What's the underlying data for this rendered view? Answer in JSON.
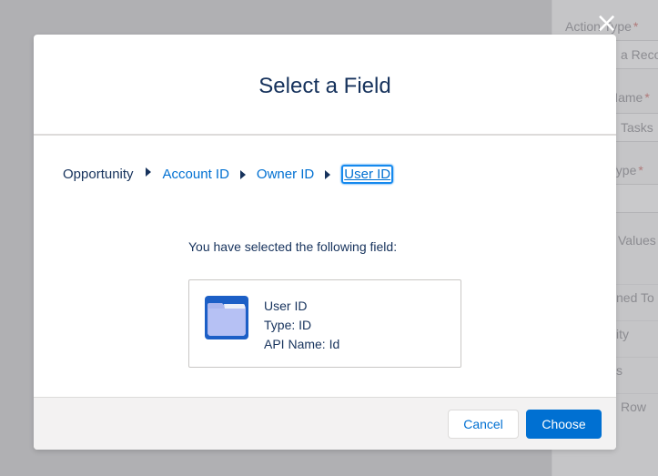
{
  "background": {
    "labels": [
      {
        "text": "Action Type",
        "required": "*"
      },
      {
        "text": "Name",
        "required": "*"
      },
      {
        "text": "Type",
        "required": "*"
      }
    ],
    "inputs": [
      "a Reco",
      "Tasks"
    ],
    "set_values_label": "Values",
    "rows": [
      "ned To",
      "ity",
      "s",
      "Row"
    ],
    "close_icon": "×"
  },
  "modal": {
    "title": "Select a Field",
    "breadcrumb": {
      "root": "Opportunity",
      "items": [
        "Account ID",
        "Owner ID"
      ],
      "active": "User ID"
    },
    "selected_prompt": "You have selected the following field:",
    "field": {
      "icon": "folder-icon",
      "name": "User ID",
      "type_line": "Type: ID",
      "api_line": "API Name: Id"
    },
    "footer": {
      "cancel_label": "Cancel",
      "choose_label": "Choose"
    }
  },
  "colors": {
    "brand": "#0070d2",
    "text": "#16325c",
    "overlay": "#b0b0b3"
  }
}
